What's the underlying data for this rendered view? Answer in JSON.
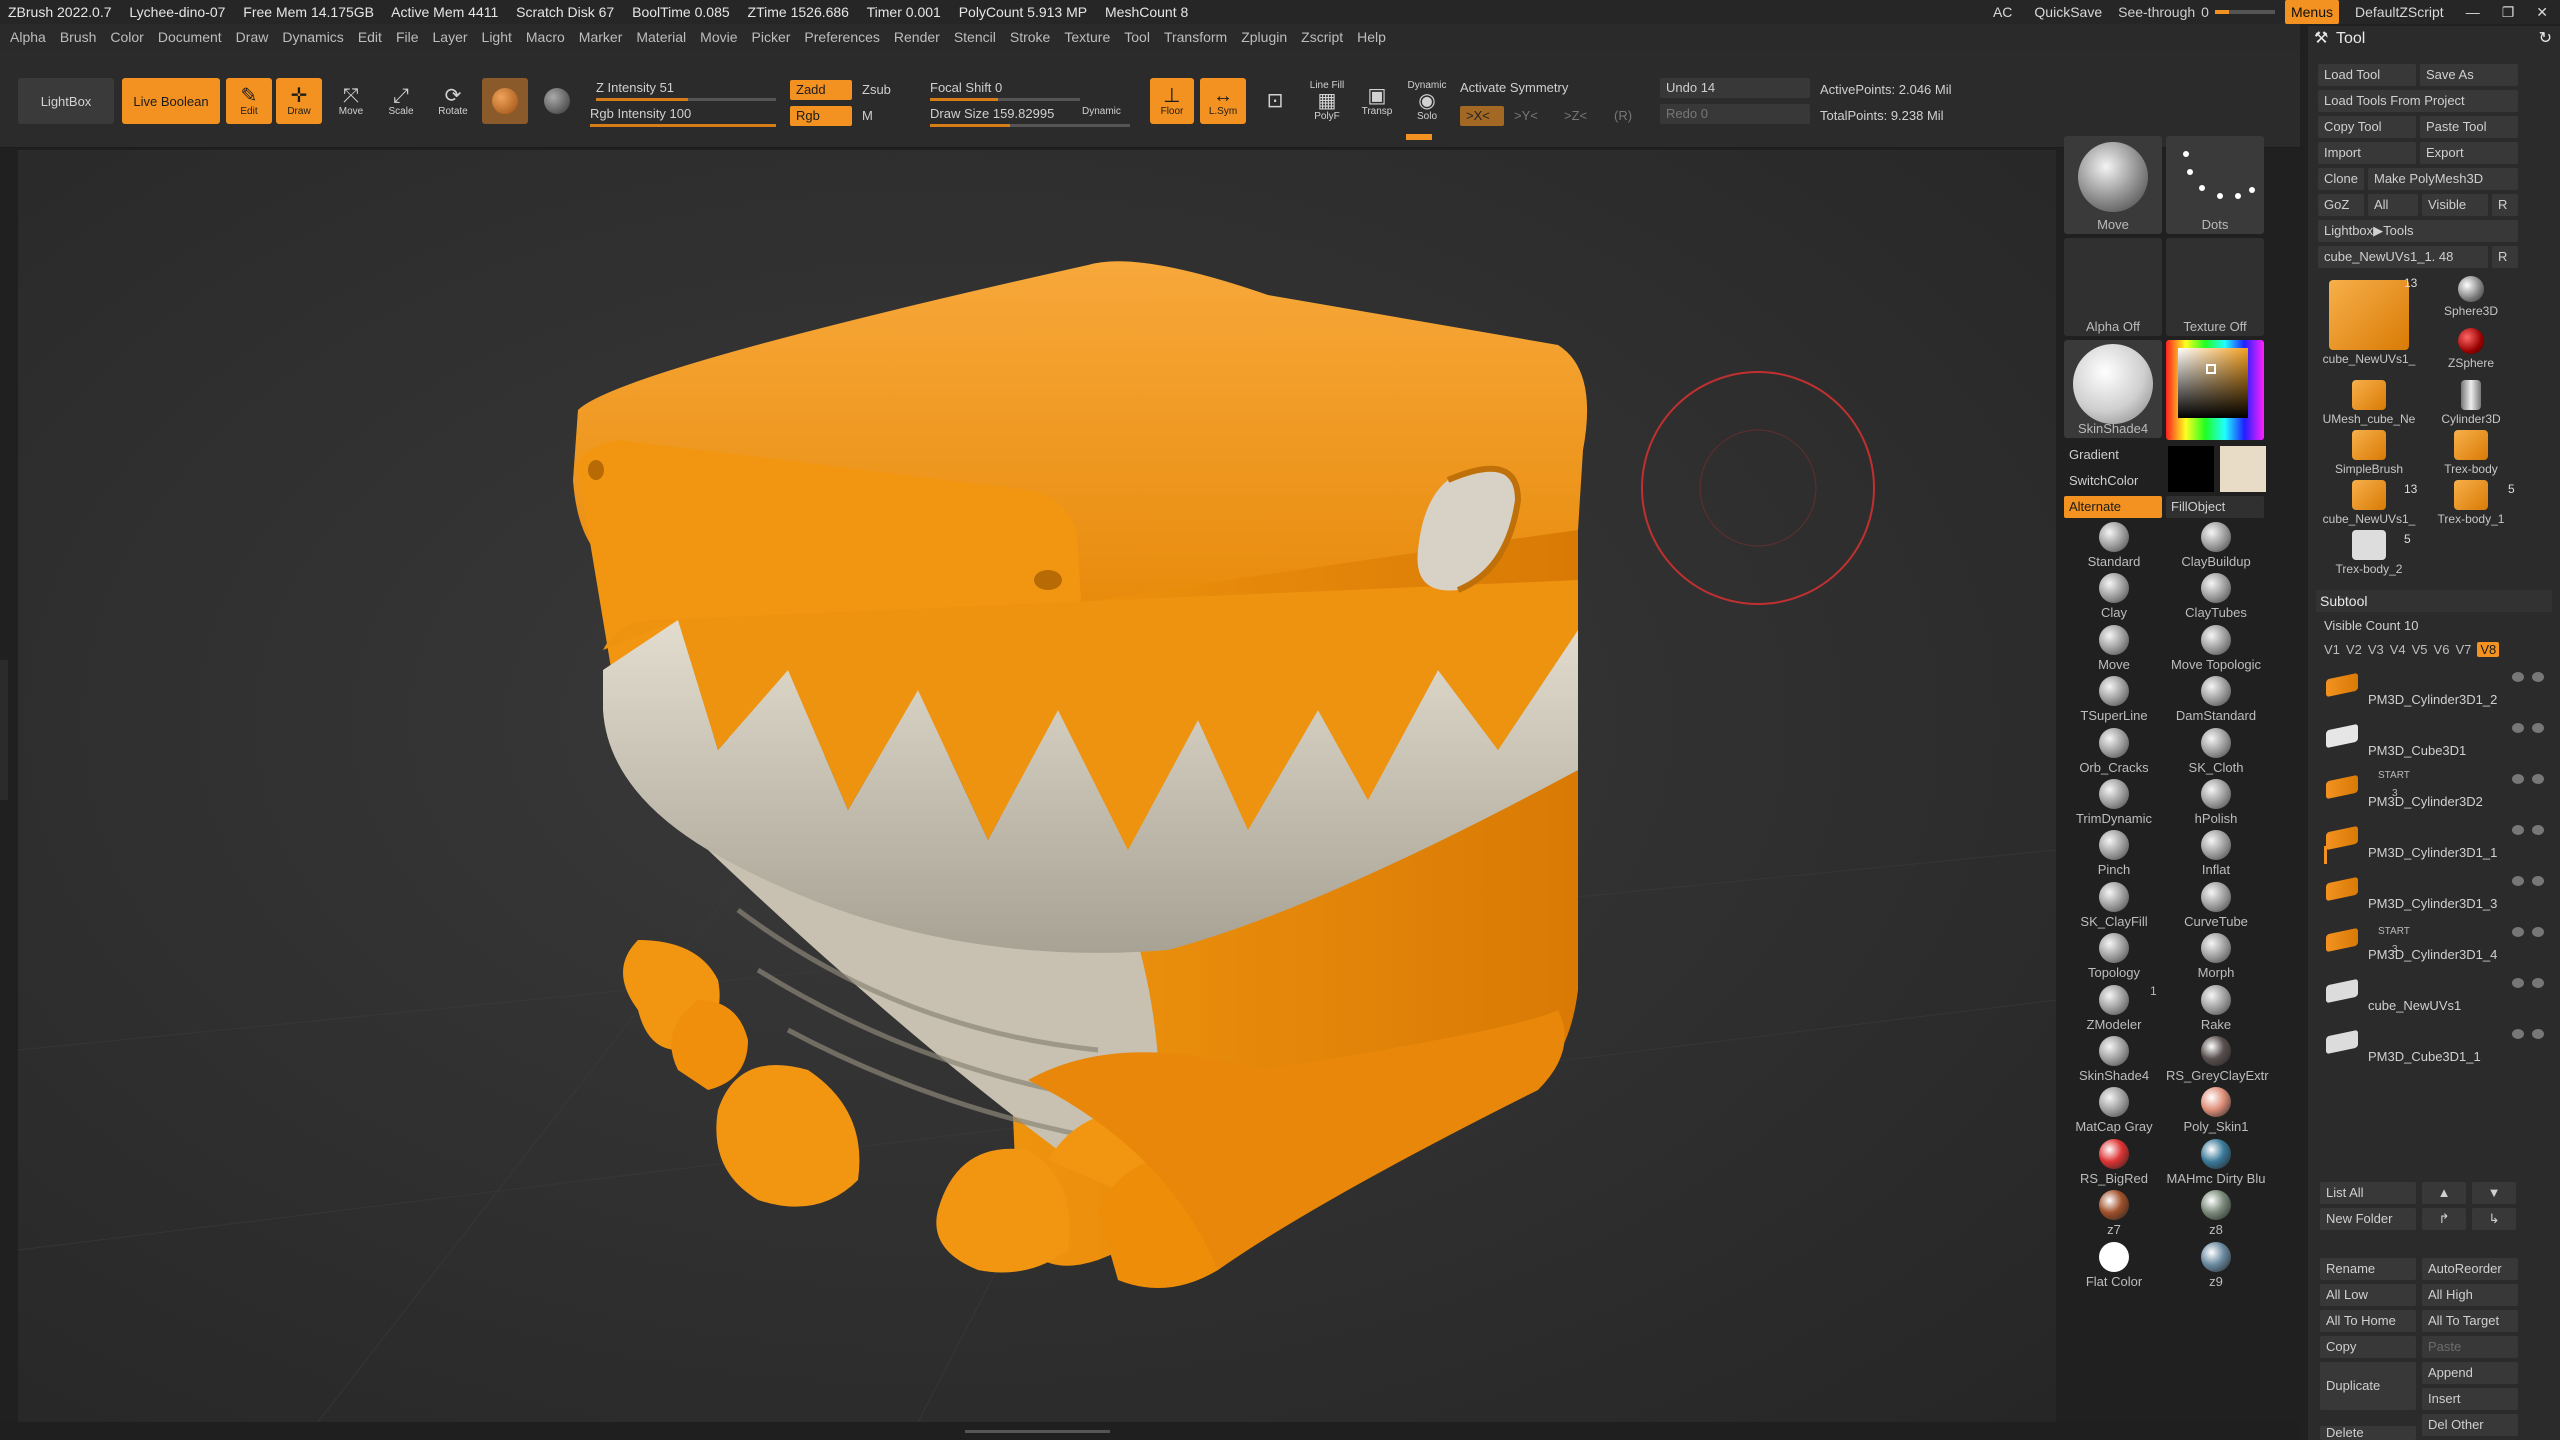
{
  "titlebar": {
    "app": "ZBrush 2022.0.7",
    "project": "Lychee-dino-07",
    "free_mem": "Free Mem 14.175GB",
    "active_mem": "Active Mem 4411",
    "scratch": "Scratch Disk 67",
    "booltime": "BoolTime 0.085",
    "ztime": "ZTime 1526.686",
    "timer": "Timer 0.001",
    "polycount": "PolyCount 5.913 MP",
    "meshcount": "MeshCount 8",
    "ac": "AC",
    "quicksave": "QuickSave",
    "seethrough": "See-through",
    "seethrough_val": "0",
    "menus": "Menus",
    "script": "DefaultZScript"
  },
  "menus": [
    "Alpha",
    "Brush",
    "Color",
    "Document",
    "Draw",
    "Dynamics",
    "Edit",
    "File",
    "Layer",
    "Light",
    "Macro",
    "Marker",
    "Material",
    "Movie",
    "Picker",
    "Preferences",
    "Render",
    "Stencil",
    "Stroke",
    "Texture",
    "Tool",
    "Transform",
    "Zplugin",
    "Zscript",
    "Help"
  ],
  "toolbar": {
    "lightbox": "LightBox",
    "live_boolean": "Live Boolean",
    "edit": "Edit",
    "draw": "Draw",
    "move": "Move",
    "scale": "Scale",
    "rotate": "Rotate",
    "z_intensity": "Z Intensity 51",
    "rgb_intensity": "Rgb Intensity 100",
    "z_intensity_val": 51,
    "rgb_intensity_val": 100,
    "zadd": "Zadd",
    "zsub": "Zsub",
    "rgb": "Rgb",
    "m": "M",
    "focal_shift": "Focal Shift 0",
    "draw_size": "Draw Size 159.82995",
    "dynamic": "Dynamic",
    "floor": "Floor",
    "lsym": "L.Sym",
    "polyf": "PolyF",
    "transp": "Transp",
    "solo": "Solo",
    "line_fill": "Line Fill",
    "dynamic_solo": "Dynamic",
    "activate_symmetry": "Activate Symmetry",
    "sym_x": ">X<",
    "sym_y": ">Y<",
    "sym_z": ">Z<",
    "sym_r": "(R)",
    "undo": "Undo 14",
    "redo": "Redo 0",
    "active_points": "ActivePoints: 2.046 Mil",
    "total_points": "TotalPoints: 9.238 Mil"
  },
  "brushes": {
    "move": "Move",
    "dots": "Dots",
    "alpha_off": "Alpha Off",
    "texture_off": "Texture Off",
    "skinshade": "SkinShade4",
    "gradient": "Gradient",
    "switchcolor": "SwitchColor",
    "alternate": "Alternate",
    "fillobject": "FillObject",
    "list": [
      "Standard",
      "ClayBuildup",
      "Clay",
      "ClayTubes",
      "Move",
      "Move Topologic",
      "TSuperLine",
      "DamStandard",
      "Orb_Cracks",
      "SK_Cloth",
      "TrimDynamic",
      "hPolish",
      "Pinch",
      "Inflat",
      "SK_ClayFill",
      "CurveTube",
      "Topology",
      "Morph",
      "ZModeler",
      "Rake",
      "SkinShade4",
      "RS_GreyClayExtr",
      "MatCap Gray",
      "Poly_Skin1",
      "RS_BigRed",
      "MAHmc Dirty Blu",
      "z7",
      "z8",
      "Flat Color",
      "z9"
    ],
    "zmodeler_badge": "1"
  },
  "colors": {
    "accent": "#f39220",
    "dino": "#f2930e",
    "teeth": "#cfc8b8"
  },
  "tool": {
    "title": "Tool",
    "load_tool": "Load Tool",
    "save_as": "Save As",
    "load_from_project": "Load Tools From Project",
    "copy_tool": "Copy Tool",
    "paste_tool": "Paste Tool",
    "import": "Import",
    "export": "Export",
    "clone": "Clone",
    "make_polymesh": "Make PolyMesh3D",
    "goz": "GoZ",
    "all": "All",
    "visible": "Visible",
    "r": "R",
    "lightbox_tools": "Lightbox▶Tools",
    "current_tool": "cube_NewUVs1_1. 48",
    "thumbs": [
      "cube_NewUVs1_",
      "Sphere3D",
      "ZSphere",
      "UMesh_cube_Ne",
      "Cylinder3D",
      "SimpleBrush",
      "Trex-body",
      "cube_NewUVs1_",
      "Trex-body_1",
      "Trex-body_2"
    ],
    "thumb_badges": [
      "13",
      "13",
      "5",
      "5"
    ]
  },
  "subtool": {
    "title": "Subtool",
    "visible_count": "Visible Count 10",
    "tabs": [
      "V1",
      "V2",
      "V3",
      "V4",
      "V5",
      "V6",
      "V7",
      "V8"
    ],
    "start": "START",
    "items": [
      "PM3D_Cylinder3D1_2",
      "PM3D_Cube3D1",
      "PM3D_Cylinder3D2",
      "PM3D_Cylinder3D1_1",
      "PM3D_Cylinder3D1_3",
      "PM3D_Cylinder3D1_4",
      "cube_NewUVs1",
      "PM3D_Cube3D1_1"
    ],
    "item_badges": [
      "3",
      "3"
    ],
    "list_all": "List All",
    "new_folder": "New Folder",
    "rename": "Rename",
    "autoreorder": "AutoReorder",
    "all_low": "All Low",
    "all_high": "All High",
    "all_to_home": "All To Home",
    "all_to_target": "All To Target",
    "copy": "Copy",
    "paste": "Paste",
    "append": "Append",
    "duplicate": "Duplicate",
    "insert": "Insert",
    "del_other": "Del Other",
    "delete": "Delete"
  }
}
